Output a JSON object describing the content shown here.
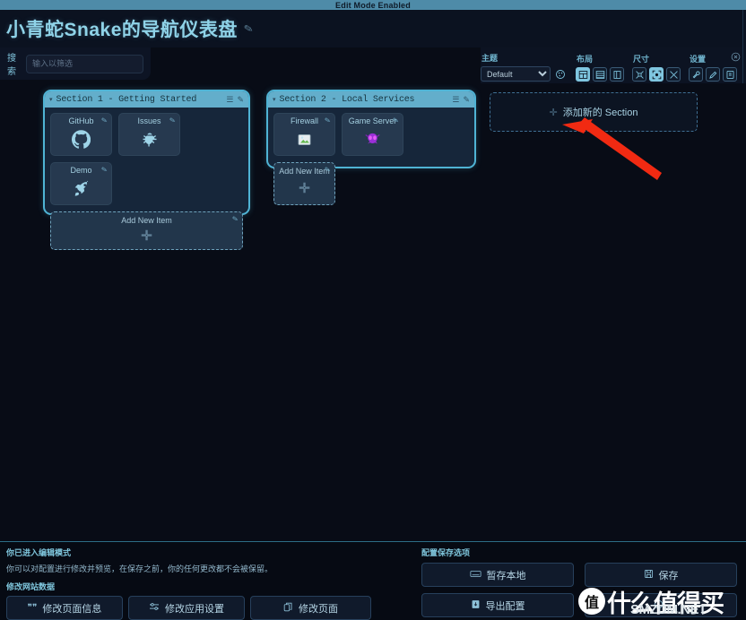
{
  "banner": {
    "text": "Edit Mode Enabled"
  },
  "header": {
    "title": "小青蛇Snake的导航仪表盘",
    "edit_icon": "pencil-icon"
  },
  "search": {
    "label": "搜索",
    "placeholder": "输入以筛选",
    "value": ""
  },
  "toolbar": {
    "groups": [
      {
        "label": "主题",
        "selected": "Default",
        "options": [
          "Default"
        ],
        "extra_icon": "palette-icon"
      },
      {
        "label": "布局",
        "buttons": [
          "layout-grid-icon",
          "layout-list-icon",
          "layout-columns-icon"
        ],
        "active_index": 0
      },
      {
        "label": "尺寸",
        "buttons": [
          "size-small-icon",
          "size-medium-icon",
          "size-large-icon"
        ],
        "active_index": 1
      },
      {
        "label": "设置",
        "buttons": [
          "wrench-icon",
          "pencil-icon",
          "config-icon"
        ],
        "active_index": -1
      }
    ],
    "close_icon": "close-circle-icon"
  },
  "board": {
    "sections": [
      {
        "title": "Section 1 - Getting Started",
        "caret": "▾",
        "head_icons": [
          "list-icon",
          "pencil-icon"
        ],
        "items": [
          {
            "label": "GitHub",
            "icon": "github-icon"
          },
          {
            "label": "Issues",
            "icon": "bug-icon"
          },
          {
            "label": "Demo",
            "icon": "rocket-icon"
          }
        ],
        "add_item": {
          "label": "Add New Item",
          "plus": "✛",
          "edit_icon": "pencil-icon"
        }
      },
      {
        "title": "Section 2 - Local Services",
        "caret": "▾",
        "head_icons": [
          "list-icon",
          "pencil-icon"
        ],
        "items": [
          {
            "label": "Firewall",
            "icon": "image-icon"
          },
          {
            "label": "Game Server",
            "icon": "alien-icon"
          }
        ],
        "add_item": {
          "label": "Add New Item",
          "plus": "✛",
          "edit_icon": "pencil-icon"
        }
      }
    ],
    "add_section": {
      "plus": "✛",
      "label": "添加新的 Section"
    },
    "annotation": {
      "type": "red-arrow",
      "color": "#f12a12"
    }
  },
  "footer": {
    "left": {
      "title": "你已进入编辑模式",
      "description": "你可以对配置进行修改并预览，在保存之前，你的任何更改都不会被保留。",
      "subtitle": "修改网站数据",
      "buttons": [
        {
          "icon": "quote-icon",
          "label": "修改页面信息"
        },
        {
          "icon": "sliders-icon",
          "label": "修改应用设置"
        },
        {
          "icon": "copy-icon",
          "label": "修改页面"
        }
      ]
    },
    "right": {
      "title": "配置保存选项",
      "buttons": [
        {
          "icon": "keyboard-icon",
          "label": "暂存本地"
        },
        {
          "icon": "save-icon",
          "label": "保存"
        },
        {
          "icon": "download-icon",
          "label": "导出配置"
        },
        {
          "icon": "clock-icon",
          "label": ""
        }
      ]
    }
  },
  "watermark": {
    "badge": "值",
    "text": "什么值得买",
    "sub": "SMZDM.NET"
  },
  "colors": {
    "accent": "#4fb3d4",
    "section_head": "#63aecb",
    "title": "#8fd3e8",
    "bg": "#080c16",
    "tile": "#26394f",
    "arrow": "#f12a12"
  }
}
